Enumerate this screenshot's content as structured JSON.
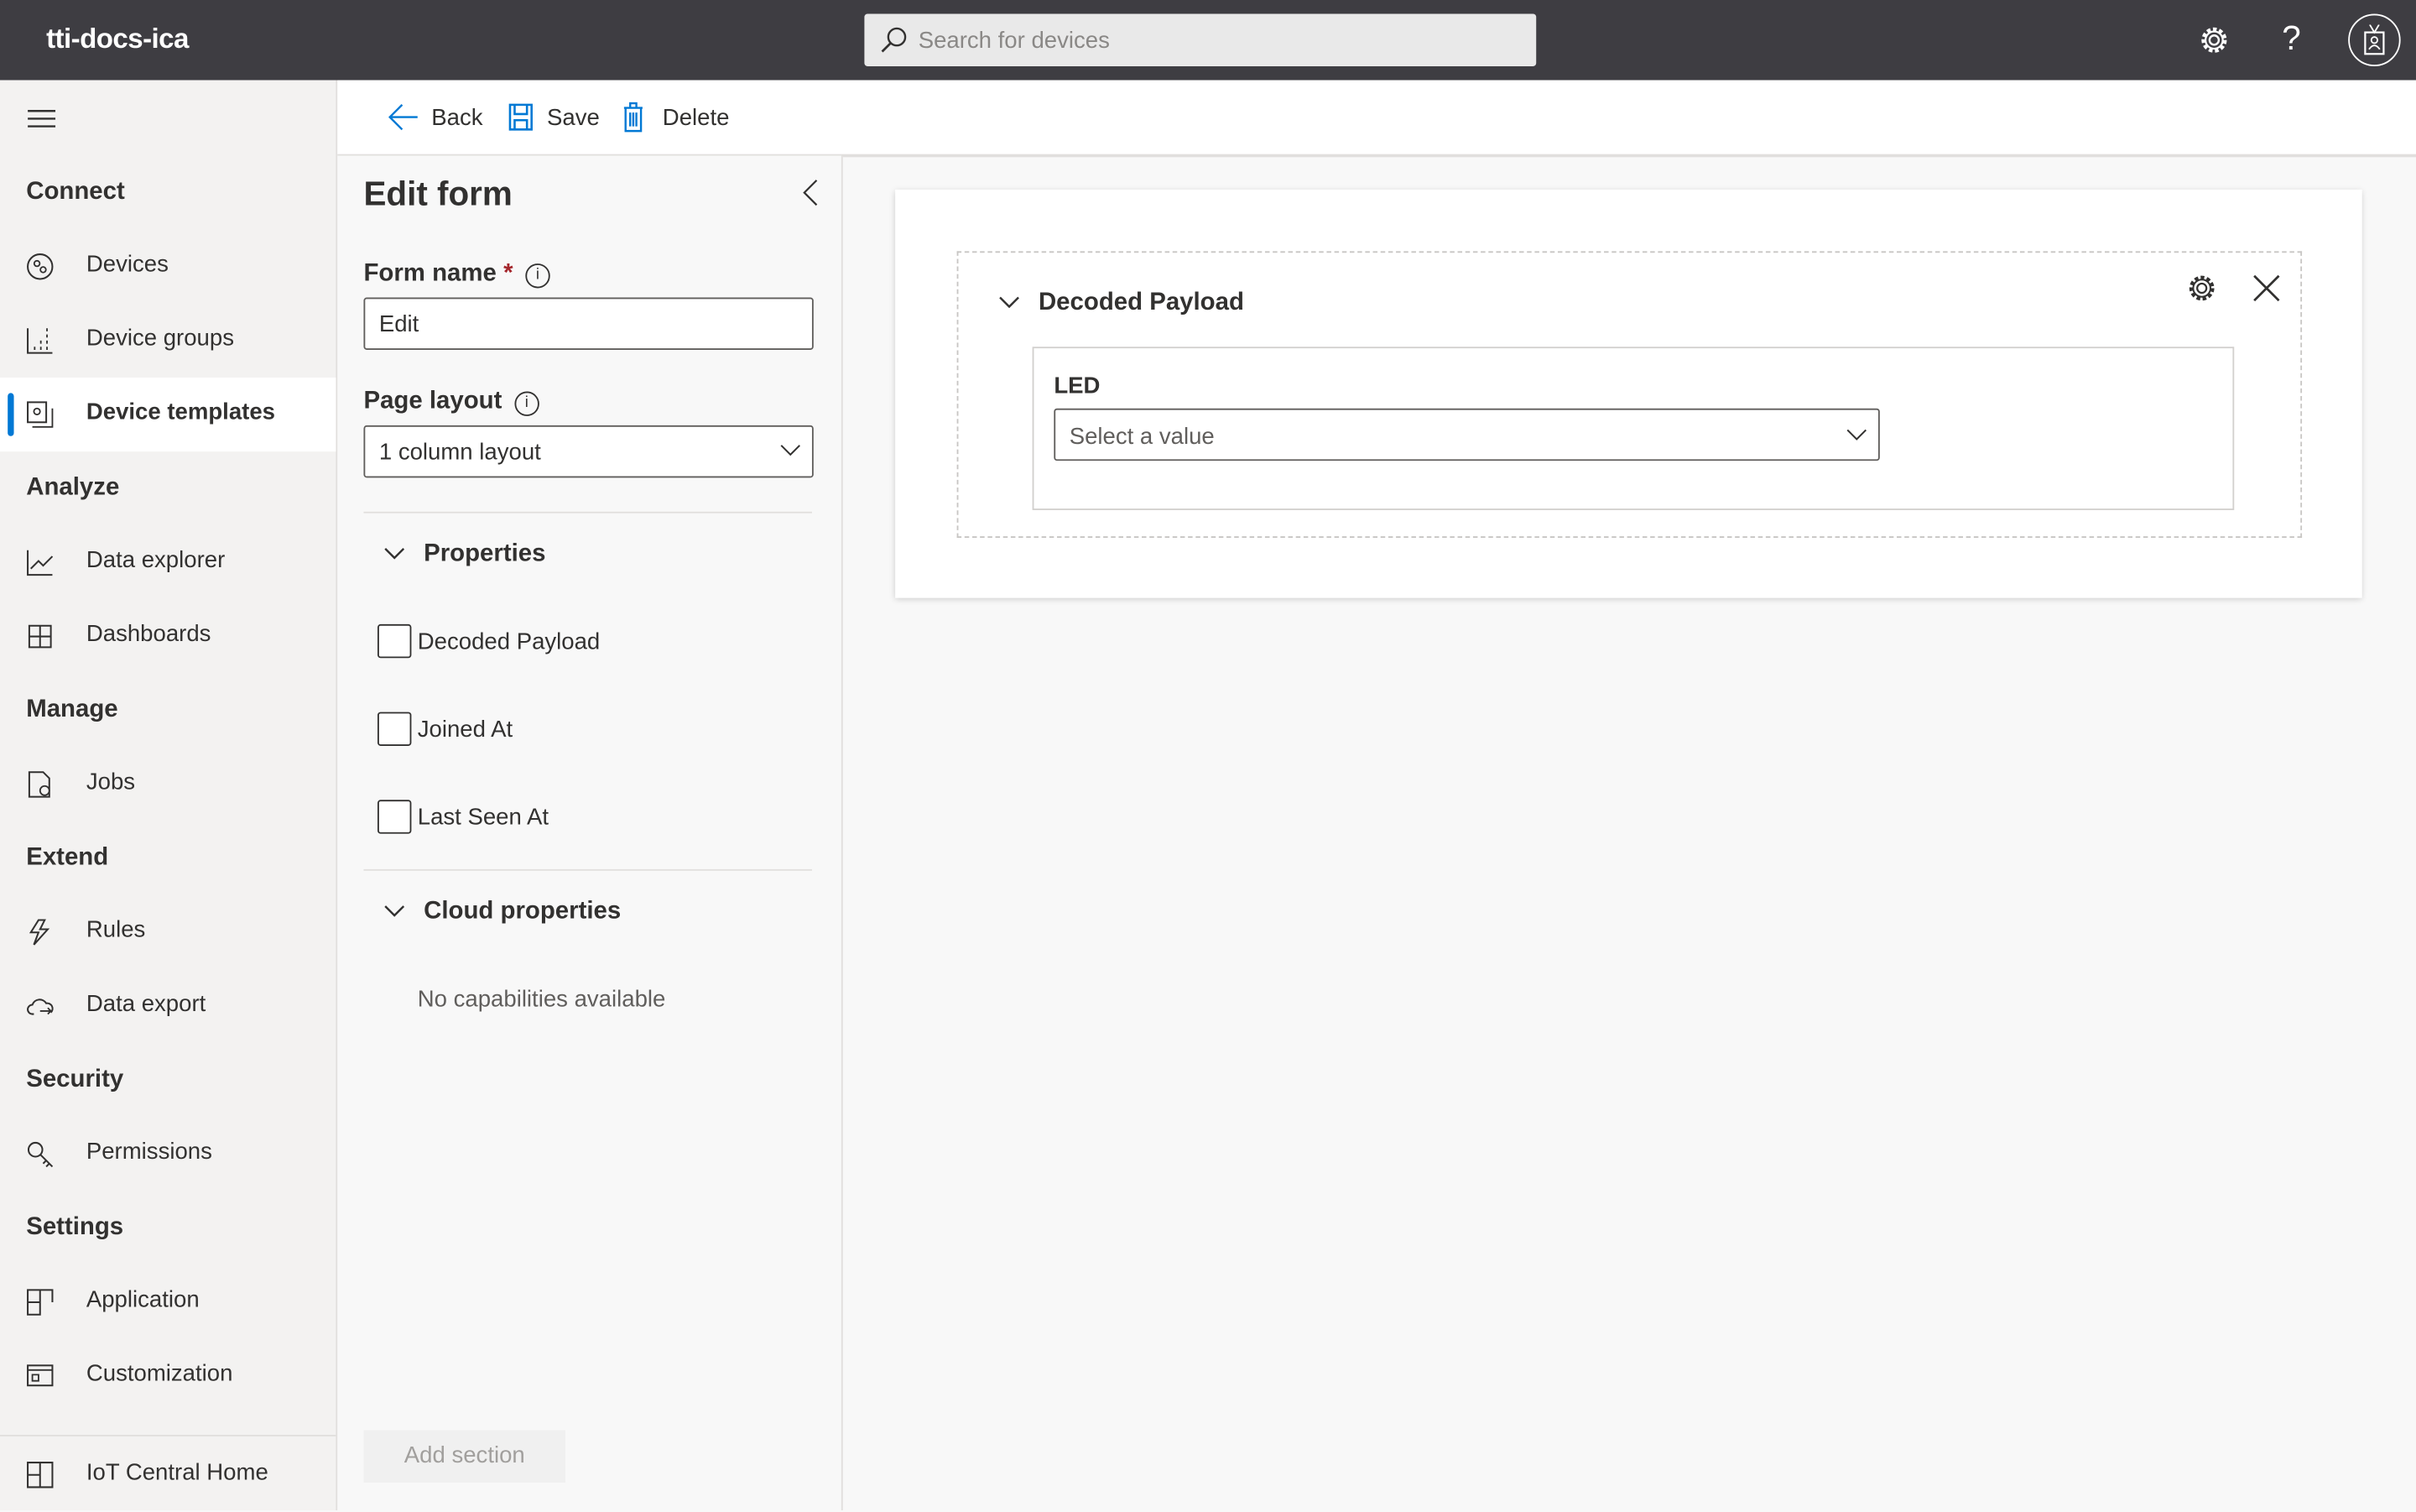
{
  "app": {
    "title": "tti-docs-ica",
    "search_placeholder": "Search for devices"
  },
  "header_icons": [
    "gear-icon",
    "help-icon",
    "avatar-badge-icon"
  ],
  "sidebar": {
    "sections": [
      {
        "label": "Connect",
        "items": [
          {
            "label": "Devices"
          },
          {
            "label": "Device groups"
          },
          {
            "label": "Device templates",
            "active": true
          }
        ]
      },
      {
        "label": "Analyze",
        "items": [
          {
            "label": "Data explorer"
          },
          {
            "label": "Dashboards"
          }
        ]
      },
      {
        "label": "Manage",
        "items": [
          {
            "label": "Jobs"
          }
        ]
      },
      {
        "label": "Extend",
        "items": [
          {
            "label": "Rules"
          },
          {
            "label": "Data export"
          }
        ]
      },
      {
        "label": "Security",
        "items": [
          {
            "label": "Permissions"
          }
        ]
      },
      {
        "label": "Settings",
        "items": [
          {
            "label": "Application"
          },
          {
            "label": "Customization"
          }
        ]
      }
    ],
    "footer": "IoT Central Home"
  },
  "toolbar": {
    "back": "Back",
    "save": "Save",
    "delete": "Delete"
  },
  "panel": {
    "title": "Edit form",
    "form_name_label": "Form name",
    "required_mark": "*",
    "form_name_value": "Edit",
    "page_layout_label": "Page layout",
    "page_layout_value": "1 column layout",
    "properties_label": "Properties",
    "properties": [
      {
        "label": "Decoded Payload",
        "checked": false
      },
      {
        "label": "Joined At",
        "checked": false
      },
      {
        "label": "Last Seen At",
        "checked": false
      }
    ],
    "cloud_label": "Cloud properties",
    "cloud_empty": "No capabilities available",
    "add_section": "Add section"
  },
  "canvas": {
    "section_title": "Decoded Payload",
    "field_label": "LED",
    "field_placeholder": "Select a value"
  },
  "colors": {
    "accent": "#0078d4",
    "topbar": "#3e3d42",
    "required": "#a4262c"
  }
}
